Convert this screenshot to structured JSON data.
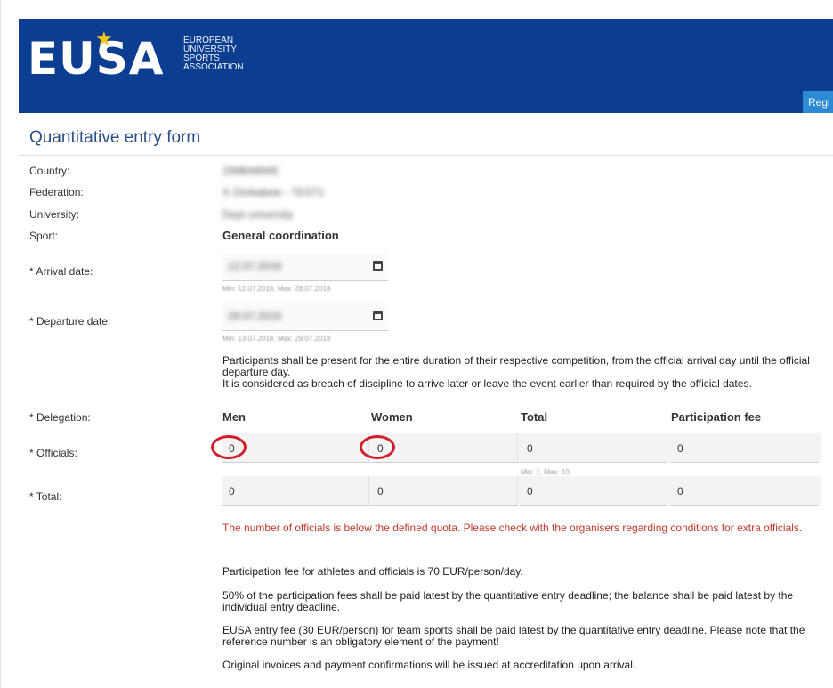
{
  "header": {
    "logo_text": "EUSA",
    "logo_subtitle": [
      "EUROPEAN",
      "UNIVERSITY",
      "SPORTS",
      "ASSOCIATION"
    ],
    "register_button": "Regi",
    "brand_color": "#0b3d91",
    "star_color": "#f7c71b"
  },
  "form": {
    "title": "Quantitative entry form",
    "country": {
      "label": "Country:",
      "value": "ZIMBABWE"
    },
    "federation": {
      "label": "Federation:",
      "value": "X Zimbabwe - TEST1"
    },
    "university": {
      "label": "University:",
      "value": "Dept university"
    },
    "sport": {
      "label": "Sport:",
      "value": "General coordination"
    },
    "arrival": {
      "label": "* Arrival date:",
      "value": "12.07.2018",
      "hint": "Min: 12.07.2018, Max: 28.07.2018"
    },
    "departure": {
      "label": "* Departure date:",
      "value": "29.07.2018",
      "hint": "Min: 13.07.2018, Max: 29.07.2018"
    },
    "presence_note_1": "Participants shall be present for the entire duration of their respective competition, from the official arrival day until the official departure day.",
    "presence_note_2": "It is considered as breach of discipline to arrive later or leave the event earlier than required by the official dates.",
    "delegation": {
      "label": "* Delegation:",
      "columns": [
        "Men",
        "Women",
        "Total",
        "Participation fee"
      ]
    },
    "officials": {
      "label": "* Officials:",
      "values": [
        "0",
        "0",
        "0",
        "0"
      ],
      "hint": "Min: 1, Max: 10"
    },
    "total": {
      "label": "* Total:",
      "values": [
        "0",
        "0",
        "0",
        "0"
      ]
    },
    "warning": "The number of officials is below the defined quota. Please check with the organisers regarding conditions for extra officials.",
    "info": [
      "Participation fee for athletes and officials is 70 EUR/person/day.",
      "50% of the participation fees shall be paid latest by the quantitative entry deadline; the balance shall be paid latest by the individual entry deadline.",
      "EUSA entry fee (30 EUR/person) for team sports shall be paid latest by the quantitative entry deadline. Please note that the reference number is an obligatory element of the payment!",
      "Original invoices and payment confirmations will be issued at accreditation upon arrival."
    ],
    "highlight_color": "#d21f2a"
  }
}
